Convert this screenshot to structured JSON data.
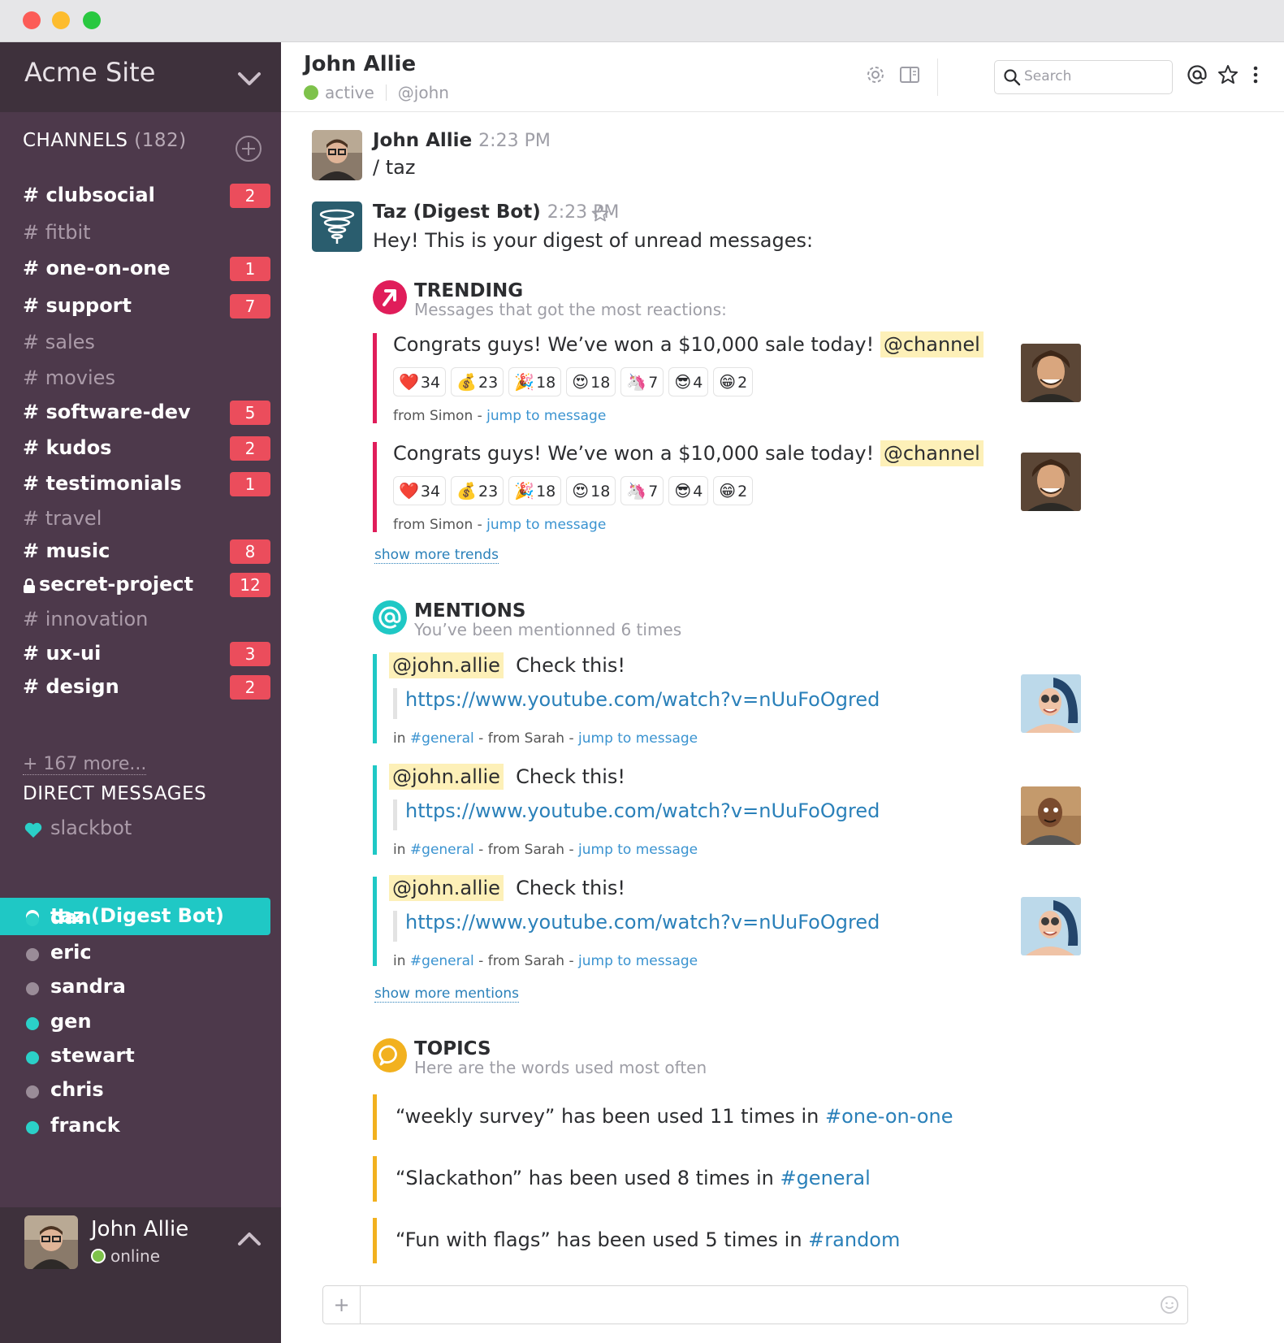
{
  "sidebar": {
    "team_name": "Acme Site",
    "channels_title": "CHANNELS",
    "channels_count": "(182)",
    "channels": [
      {
        "label": "# clubsocial",
        "badge": "2",
        "unread": true
      },
      {
        "label": "# fitbit",
        "badge": "",
        "unread": false
      },
      {
        "label": "# one-on-one",
        "badge": "1",
        "unread": true
      },
      {
        "label": "# support",
        "badge": "7",
        "unread": true
      },
      {
        "label": "# sales",
        "badge": "",
        "unread": false
      },
      {
        "label": "# movies",
        "badge": "",
        "unread": false
      },
      {
        "label": "# software-dev",
        "badge": "5",
        "unread": true
      },
      {
        "label": "# kudos",
        "badge": "2",
        "unread": true
      },
      {
        "label": "# testimonials",
        "badge": "1",
        "unread": true
      },
      {
        "label": "# travel",
        "badge": "",
        "unread": false
      },
      {
        "label": "# music",
        "badge": "8",
        "unread": true
      },
      {
        "label": "secret-project",
        "badge": "12",
        "unread": true,
        "icon": "lock-icon"
      },
      {
        "label": "# innovation",
        "badge": "",
        "unread": false
      },
      {
        "label": "# ux-ui",
        "badge": "3",
        "unread": true
      },
      {
        "label": "# design",
        "badge": "2",
        "unread": true
      }
    ],
    "more_label": "+ 167 more...",
    "dm_title": "DIRECT MESSAGES",
    "dms": [
      {
        "label": "slackbot",
        "icon": "heart-icon"
      },
      {
        "label": "taz (Digest Bot)",
        "active": true
      },
      {
        "label": "dan",
        "online": true
      },
      {
        "label": "eric",
        "online": false
      },
      {
        "label": "sandra",
        "online": false
      },
      {
        "label": "gen",
        "online": true
      },
      {
        "label": "stewart",
        "online": true
      },
      {
        "label": "chris",
        "online": false
      },
      {
        "label": "franck",
        "online": true
      }
    ],
    "me": {
      "name": "John Allie",
      "status": "online"
    }
  },
  "header": {
    "name": "John Allie",
    "status": "active",
    "handle": "@john",
    "search_placeholder": "Search"
  },
  "messages": [
    {
      "author": "John Allie",
      "time": "2:23 PM",
      "text": "/ taz"
    },
    {
      "author": "Taz (Digest Bot)",
      "time": "2:23 PM",
      "text": "Hey! This is your digest of unread messages:"
    }
  ],
  "trending": {
    "title": "TRENDING",
    "subtitle": "Messages that got the most reactions:",
    "items": [
      {
        "text": "Congrats guys! We’ve won a $10,000 sale today!",
        "mention": "@channel",
        "reactions": [
          {
            "emoji": "❤️",
            "count": "34"
          },
          {
            "emoji": "💰",
            "count": "23"
          },
          {
            "emoji": "🎉",
            "count": "18"
          },
          {
            "emoji": "😍",
            "count": "18"
          },
          {
            "emoji": "🦄",
            "count": "7"
          },
          {
            "emoji": "😎",
            "count": "4"
          },
          {
            "emoji": "😁",
            "count": "2"
          }
        ],
        "from": "from Simon - ",
        "jump": "jump to message"
      },
      {
        "text": "Congrats guys! We’ve won a $10,000 sale today!",
        "mention": "@channel",
        "reactions": [
          {
            "emoji": "❤️",
            "count": "34"
          },
          {
            "emoji": "💰",
            "count": "23"
          },
          {
            "emoji": "🎉",
            "count": "18"
          },
          {
            "emoji": "😍",
            "count": "18"
          },
          {
            "emoji": "🦄",
            "count": "7"
          },
          {
            "emoji": "😎",
            "count": "4"
          },
          {
            "emoji": "😁",
            "count": "2"
          }
        ],
        "from": "from Simon - ",
        "jump": "jump to message"
      }
    ],
    "show_more": "show more trends"
  },
  "mentions": {
    "title": "MENTIONS",
    "subtitle": "You’ve been mentionned 6 times",
    "items": [
      {
        "mention": "@john.allie",
        "text": "Check this!",
        "url": "https://www.youtube.com/watch?v=nUuFoOgred",
        "in": "in ",
        "channel": "#general",
        "from": " - from Sarah - ",
        "jump": "jump to message"
      },
      {
        "mention": "@john.allie",
        "text": "Check this!",
        "url": "https://www.youtube.com/watch?v=nUuFoOgred",
        "in": "in ",
        "channel": "#general",
        "from": " - from Sarah - ",
        "jump": "jump to message"
      },
      {
        "mention": "@john.allie",
        "text": "Check this!",
        "url": "https://www.youtube.com/watch?v=nUuFoOgred",
        "in": "in ",
        "channel": "#general",
        "from": " - from Sarah - ",
        "jump": "jump to message"
      }
    ],
    "show_more": "show more mentions"
  },
  "topics": {
    "title": "TOPICS",
    "subtitle": "Here are the words used most often",
    "items": [
      {
        "text": "“weekly survey” has been used 11 times in ",
        "channel": "#one-on-one"
      },
      {
        "text": "“Slackathon” has been used 8 times in ",
        "channel": "#general"
      },
      {
        "text": "“Fun with flags” has been used 5 times in ",
        "channel": "#random"
      }
    ]
  },
  "composer": {
    "plus": "+"
  },
  "colors": {
    "sidebar": "#4d394b",
    "active": "#1fc8c5",
    "badge": "#eb4d5c",
    "trending": "#e01d5a",
    "mentions": "#1fc8c5",
    "topics": "#f2b11f"
  }
}
